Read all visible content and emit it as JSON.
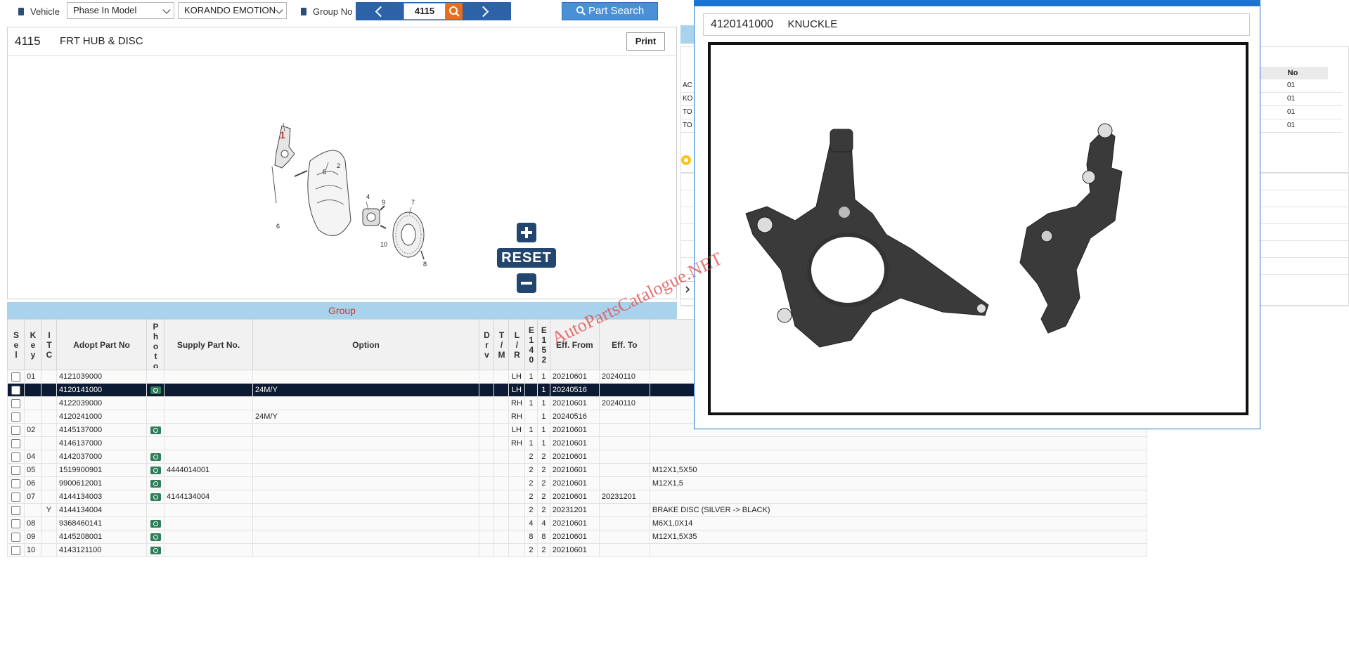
{
  "toolbar": {
    "vehicle_label": "Vehicle",
    "phase_select": "Phase In Model",
    "model_select": "KORANDO EMOTION",
    "group_label": "Group No",
    "group_value": "4115",
    "part_search_label": "Part Search"
  },
  "diagram": {
    "group_code": "4115",
    "group_name": "FRT HUB & DISC",
    "print_label": "Print",
    "reset_label": "RESET",
    "callouts": [
      "1",
      "2",
      "4",
      "5",
      "6",
      "7",
      "8",
      "9",
      "10"
    ]
  },
  "group_bar": {
    "title": "Group"
  },
  "table": {
    "headers": {
      "sel": "Sel",
      "key": "Key",
      "itc": "ITC",
      "adopt": "Adopt Part No",
      "photo": "Photo",
      "supply": "Supply Part No.",
      "option": "Option",
      "drv": "Drv",
      "tm": "T/M",
      "lr": "L/R",
      "e140": "E140",
      "e152": "E152",
      "eff_from": "Eff. From",
      "eff_to": "Eff. To"
    },
    "rows": [
      {
        "key": "01",
        "itc": "",
        "adopt": "4121039000",
        "photo": false,
        "supply": "",
        "option": "",
        "lr": "LH",
        "e140": "1",
        "e152": "1",
        "from": "20210601",
        "to": "20240110",
        "remark": ""
      },
      {
        "key": "",
        "itc": "",
        "adopt": "4120141000",
        "photo": true,
        "supply": "",
        "option": "24M/Y",
        "lr": "LH",
        "e140": "",
        "e152": "1",
        "from": "20240516",
        "to": "",
        "remark": ""
      },
      {
        "key": "",
        "itc": "",
        "adopt": "4122039000",
        "photo": false,
        "supply": "",
        "option": "",
        "lr": "RH",
        "e140": "1",
        "e152": "1",
        "from": "20210601",
        "to": "20240110",
        "remark": ""
      },
      {
        "key": "",
        "itc": "",
        "adopt": "4120241000",
        "photo": false,
        "supply": "",
        "option": "24M/Y",
        "lr": "RH",
        "e140": "",
        "e152": "1",
        "from": "20240516",
        "to": "",
        "remark": ""
      },
      {
        "key": "02",
        "itc": "",
        "adopt": "4145137000",
        "photo": true,
        "supply": "",
        "option": "",
        "lr": "LH",
        "e140": "1",
        "e152": "1",
        "from": "20210601",
        "to": "",
        "remark": ""
      },
      {
        "key": "",
        "itc": "",
        "adopt": "4146137000",
        "photo": false,
        "supply": "",
        "option": "",
        "lr": "RH",
        "e140": "1",
        "e152": "1",
        "from": "20210601",
        "to": "",
        "remark": ""
      },
      {
        "key": "04",
        "itc": "",
        "adopt": "4142037000",
        "photo": true,
        "supply": "",
        "option": "",
        "lr": "",
        "e140": "2",
        "e152": "2",
        "from": "20210601",
        "to": "",
        "remark": ""
      },
      {
        "key": "05",
        "itc": "",
        "adopt": "1519900901",
        "photo": true,
        "supply": "4444014001",
        "option": "",
        "lr": "",
        "e140": "2",
        "e152": "2",
        "from": "20210601",
        "to": "",
        "remark": "M12X1,5X50"
      },
      {
        "key": "06",
        "itc": "",
        "adopt": "9900612001",
        "photo": true,
        "supply": "",
        "option": "",
        "lr": "",
        "e140": "2",
        "e152": "2",
        "from": "20210601",
        "to": "",
        "remark": "M12X1,5"
      },
      {
        "key": "07",
        "itc": "",
        "adopt": "4144134003",
        "photo": true,
        "supply": "4144134004",
        "option": "",
        "lr": "",
        "e140": "2",
        "e152": "2",
        "from": "20210601",
        "to": "20231201",
        "remark": ""
      },
      {
        "key": "",
        "itc": "Y",
        "adopt": "4144134004",
        "photo": false,
        "supply": "",
        "option": "",
        "lr": "",
        "e140": "2",
        "e152": "2",
        "from": "20231201",
        "to": "",
        "remark": "BRAKE DISC (SILVER -> BLACK)"
      },
      {
        "key": "08",
        "itc": "",
        "adopt": "9368460141",
        "photo": true,
        "supply": "",
        "option": "",
        "lr": "",
        "e140": "4",
        "e152": "4",
        "from": "20210601",
        "to": "",
        "remark": "M6X1,0X14"
      },
      {
        "key": "09",
        "itc": "",
        "adopt": "4145208001",
        "photo": true,
        "supply": "",
        "option": "",
        "lr": "",
        "e140": "8",
        "e152": "8",
        "from": "20210601",
        "to": "",
        "remark": "M12X1,5X35"
      },
      {
        "key": "10",
        "itc": "",
        "adopt": "4143121100",
        "photo": true,
        "supply": "",
        "option": "",
        "lr": "",
        "e140": "2",
        "e152": "2",
        "from": "20210601",
        "to": "",
        "remark": ""
      }
    ]
  },
  "side_table": {
    "header_no": "No",
    "rows": [
      {
        "code": "AC",
        "no": "01"
      },
      {
        "code": "KO",
        "no": "01"
      },
      {
        "code": "TO",
        "no": "01"
      },
      {
        "code": "TO",
        "no": "01"
      }
    ]
  },
  "modal": {
    "part_no": "4120141000",
    "part_name": "KNUCKLE",
    "watermark": "AutoPartsCatalogue.NET"
  },
  "colors": {
    "nav_blue": "#2c62a8",
    "search_blue": "#4a90d9",
    "group_bar": "#a9d2ec",
    "selected_row": "#0c1b33",
    "photo_green": "#2e7d5b",
    "modal_blue": "#1a73d0"
  }
}
